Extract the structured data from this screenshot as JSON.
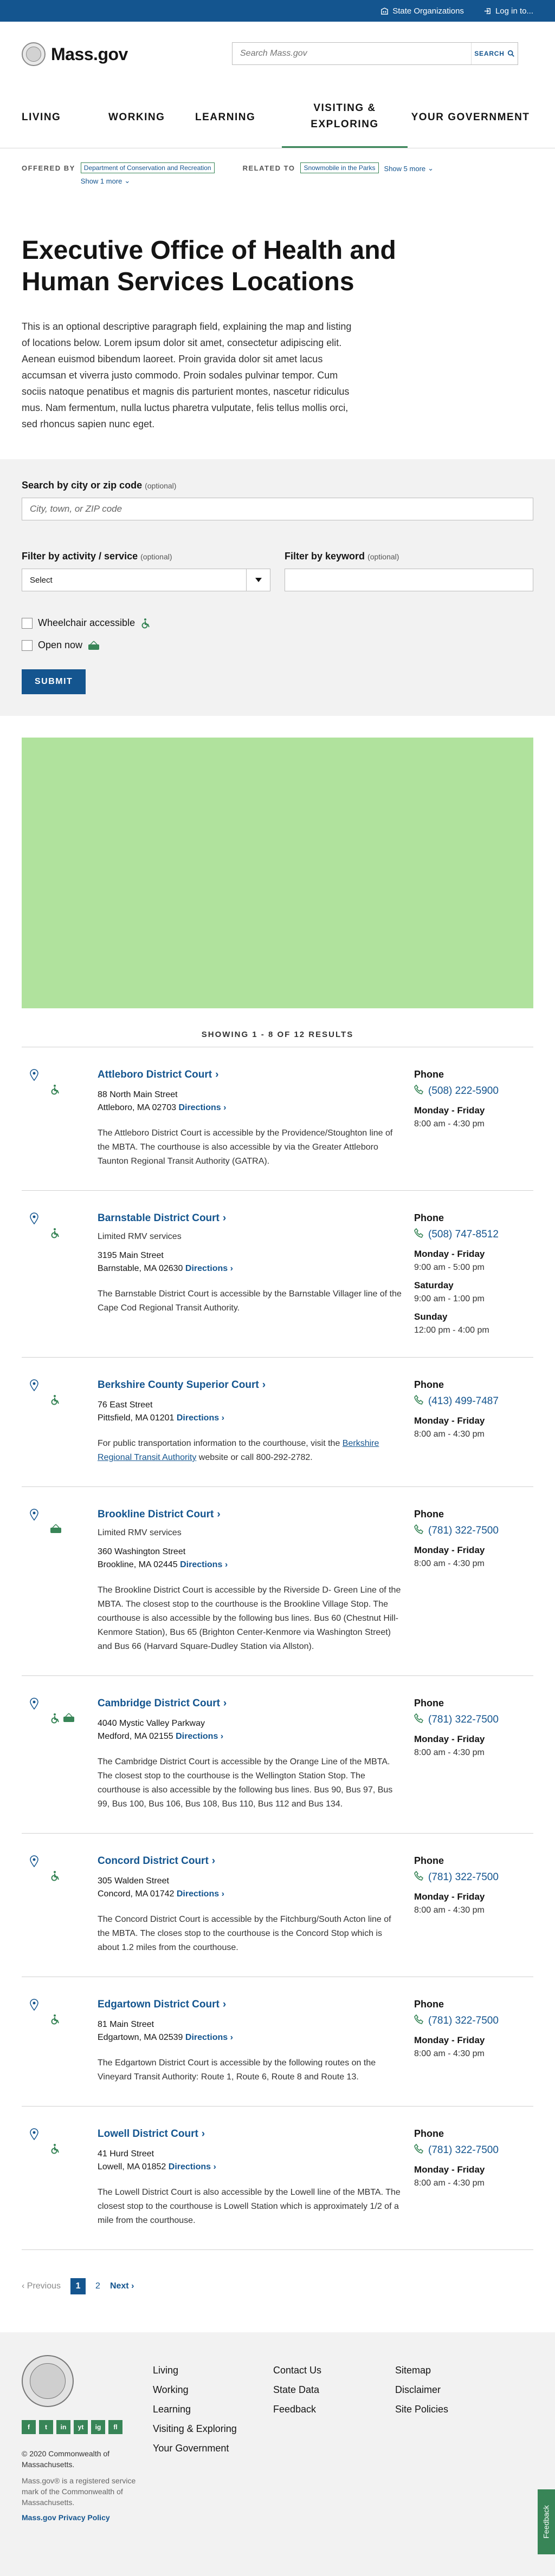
{
  "utility": {
    "state_orgs": "State Organizations",
    "login": "Log in to..."
  },
  "header": {
    "logo_text": "Mass.gov",
    "search_placeholder": "Search Mass.gov",
    "search_button": "SEARCH"
  },
  "nav": [
    "LIVING",
    "WORKING",
    "LEARNING",
    "VISITING & EXPLORING",
    "YOUR GOVERNMENT"
  ],
  "meta": {
    "offered_label": "OFFERED BY",
    "offered_tag": "Department of Conservation and Recreation",
    "offered_more": "Show 1 more",
    "related_label": "RELATED TO",
    "related_tag": "Snowmobile in the Parks",
    "related_more": "Show 5 more"
  },
  "page": {
    "title": "Executive Office of Health and Human Services Locations",
    "intro": "This is an optional descriptive paragraph field, explaining the map and listing of locations below. Lorem ipsum dolor sit amet, consectetur adipiscing elit. Aenean euismod bibendum laoreet. Proin gravida dolor sit amet lacus accumsan et viverra justo commodo. Proin sodales pulvinar tempor. Cum sociis natoque penatibus et magnis dis parturient montes, nascetur ridiculus mus. Nam fermentum, nulla luctus pharetra vulputate, felis tellus mollis orci, sed rhoncus sapien nunc eget."
  },
  "filters": {
    "search_label": "Search by city or zip code",
    "optional": "(optional)",
    "search_placeholder": "City, town, or ZIP code",
    "activity_label": "Filter by activity / service",
    "activity_value": "Select",
    "keyword_label": "Filter by keyword",
    "wheelchair": "Wheelchair accessible",
    "open_now": "Open now",
    "submit": "SUBMIT"
  },
  "results_head": "SHOWING 1 - 8 OF 12 RESULTS",
  "locations": [
    {
      "name": "Attleboro District Court",
      "sub": "",
      "addr1": "88 North Main Street",
      "addr2": "Attleboro, MA 02703",
      "desc": "The Attleboro District Court is accessible by the Providence/Stoughton line of the MBTA. The courthouse is also accessible by via the Greater Attleboro Taunton Regional Transit Authority (GATRA).",
      "phone": "(508) 222-5900",
      "hours": [
        {
          "day": "Monday - Friday",
          "time": "8:00 am - 4:30 pm"
        }
      ],
      "icons": [
        "wheelchair"
      ]
    },
    {
      "name": "Barnstable District Court",
      "sub": "Limited RMV services",
      "addr1": "3195 Main Street",
      "addr2": "Barnstable, MA 02630",
      "desc": "The Barnstable District Court is accessible by the Barnstable Villager line of the Cape Cod Regional Transit Authority.",
      "phone": "(508) 747-8512",
      "hours": [
        {
          "day": "Monday - Friday",
          "time": "9:00 am - 5:00 pm"
        },
        {
          "day": "Saturday",
          "time": "9:00 am - 1:00 pm"
        },
        {
          "day": "Sunday",
          "time": "12:00 pm - 4:00 pm"
        }
      ],
      "icons": [
        "wheelchair"
      ]
    },
    {
      "name": "Berkshire County Superior Court",
      "sub": "",
      "addr1": "76 East Street",
      "addr2": "Pittsfield, MA 01201",
      "desc": "For public transportation information to the courthouse, visit the",
      "desc_link": "Berkshire Regional Transit Authority",
      "desc_after": " website or call 800-292-2782.",
      "phone": "(413) 499-7487",
      "hours": [
        {
          "day": "Monday - Friday",
          "time": "8:00 am - 4:30 pm"
        }
      ],
      "icons": [
        "wheelchair"
      ]
    },
    {
      "name": "Brookline District Court",
      "sub": "Limited RMV services",
      "addr1": "360 Washington Street",
      "addr2": "Brookline, MA 02445",
      "desc": "The Brookline District Court is accessible by the Riverside D- Green Line of the MBTA. The closest stop to the courthouse is the Brookline Village Stop. The courthouse is also accessible by the following bus lines. Bus 60 (Chestnut Hill-Kenmore Station), Bus 65 (Brighton Center-Kenmore via Washington Street) and Bus 66 (Harvard Square-Dudley Station via Allston).",
      "phone": "(781) 322-7500",
      "hours": [
        {
          "day": "Monday - Friday",
          "time": "8:00 am - 4:30 pm"
        }
      ],
      "icons": [
        "open"
      ]
    },
    {
      "name": "Cambridge District Court",
      "sub": "",
      "addr1": "4040 Mystic Valley Parkway",
      "addr2": "Medford, MA 02155",
      "desc": "The Cambridge District Court is accessible by the Orange Line of the MBTA. The closest stop to the courthouse is the Wellington Station Stop. The courthouse is also accessible by the following bus lines. Bus 90, Bus 97, Bus 99, Bus 100, Bus 106, Bus 108, Bus 110, Bus 112 and Bus 134.",
      "phone": "(781) 322-7500",
      "hours": [
        {
          "day": "Monday - Friday",
          "time": "8:00 am - 4:30 pm"
        }
      ],
      "icons": [
        "wheelchair",
        "open"
      ]
    },
    {
      "name": "Concord District Court",
      "sub": "",
      "addr1": "305 Walden Street",
      "addr2": "Concord, MA 01742",
      "desc": "The Concord District Court is accessible by the Fitchburg/South Acton line of the MBTA. The closes stop to the courthouse is the Concord Stop which is about 1.2 miles from the courthouse.",
      "phone": "(781) 322-7500",
      "hours": [
        {
          "day": "Monday - Friday",
          "time": "8:00 am - 4:30 pm"
        }
      ],
      "icons": [
        "wheelchair"
      ]
    },
    {
      "name": "Edgartown District Court",
      "sub": "",
      "addr1": "81 Main Street",
      "addr2": "Edgartown, MA 02539",
      "desc": "The Edgartown District Court is accessible by the following routes on the Vineyard Transit Authority: Route 1, Route 6, Route 8 and Route 13.",
      "phone": "(781) 322-7500",
      "hours": [
        {
          "day": "Monday - Friday",
          "time": "8:00 am - 4:30 pm"
        }
      ],
      "icons": [
        "wheelchair"
      ]
    },
    {
      "name": "Lowell District Court",
      "sub": "",
      "addr1": "41 Hurd Street",
      "addr2": "Lowell, MA 01852",
      "desc": "The Lowell District Court is also accessible by the Lowell line of the MBTA. The closest stop to the courthouse is Lowell Station which is approximately 1/2 of a mile from the courthouse.",
      "phone": "(781) 322-7500",
      "hours": [
        {
          "day": "Monday - Friday",
          "time": "8:00 am - 4:30 pm"
        }
      ],
      "icons": [
        "wheelchair"
      ]
    }
  ],
  "labels": {
    "directions": "Directions",
    "phone": "Phone"
  },
  "pagination": {
    "prev": "Previous",
    "pages": [
      "1",
      "2"
    ],
    "next": "Next"
  },
  "footer": {
    "col1": [
      "Living",
      "Working",
      "Learning",
      "Visiting & Exploring",
      "Your Government"
    ],
    "col2": [
      "Contact Us",
      "State Data",
      "Feedback"
    ],
    "col3": [
      "Sitemap",
      "Disclaimer",
      "Site Policies"
    ],
    "copyright": "© 2020 Commonwealth of Massachusetts.",
    "trademark": "Mass.gov® is a registered service mark of the Commonwealth of Massachusetts.",
    "privacy": "Mass.gov Privacy Policy",
    "social": [
      "f",
      "t",
      "in",
      "yt",
      "ig",
      "fl"
    ],
    "feedback_tab": "Feedback"
  },
  "colors": {
    "primary": "#14558f",
    "accent": "#388557",
    "map": "#b0e29d"
  }
}
